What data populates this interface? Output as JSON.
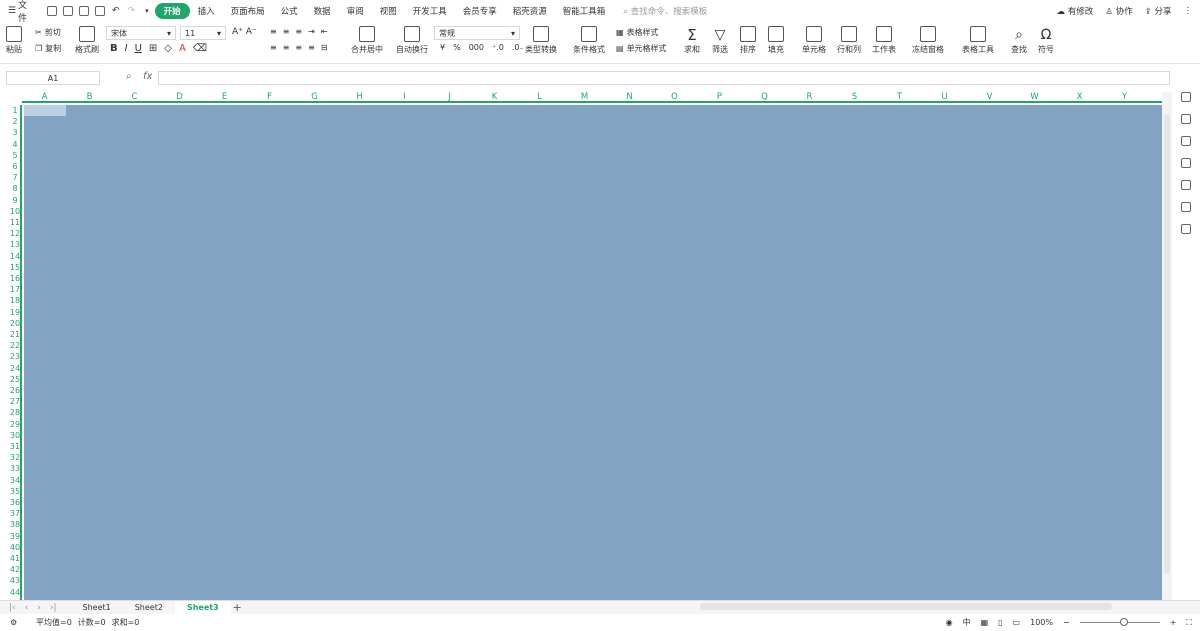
{
  "menubar": {
    "file": "文件",
    "items": [
      "开始",
      "插入",
      "页面布局",
      "公式",
      "数据",
      "审阅",
      "视图",
      "开发工具",
      "会员专享",
      "稻壳资源",
      "智能工具箱"
    ],
    "active_index": 0,
    "search_placeholder": "查找命令、搜索模板",
    "right": {
      "modify": "有修改",
      "collab": "协作",
      "share": "分享"
    }
  },
  "ribbon": {
    "paste": "粘贴",
    "cut": "剪切",
    "copy": "复制",
    "format_painter": "格式刷",
    "font_name": "宋体",
    "font_size": "11",
    "bold": "B",
    "italic": "I",
    "underline": "U",
    "merge_center": "合并居中",
    "wrap_text": "自动换行",
    "number_format": "常规",
    "currency": "¥",
    "percent": "%",
    "type_convert": "类型转换",
    "conditional_format": "条件格式",
    "table_style": "表格样式",
    "cell_style": "单元格样式",
    "sum": "求和",
    "filter": "筛选",
    "sort": "排序",
    "fill": "填充",
    "cell": "单元格",
    "row_col": "行和列",
    "worksheet": "工作表",
    "freeze": "冻结窗格",
    "table_tools": "表格工具",
    "find": "查找",
    "symbol": "符号"
  },
  "formula": {
    "name_box": "A1",
    "fx": "fx",
    "value": ""
  },
  "columns": [
    "A",
    "B",
    "C",
    "D",
    "E",
    "F",
    "G",
    "H",
    "I",
    "J",
    "K",
    "L",
    "M",
    "N",
    "O",
    "P",
    "Q",
    "R",
    "S",
    "T",
    "U",
    "V",
    "W",
    "X",
    "Y"
  ],
  "rows": [
    "1",
    "2",
    "3",
    "4",
    "5",
    "6",
    "7",
    "8",
    "9",
    "10",
    "11",
    "12",
    "13",
    "14",
    "15",
    "16",
    "17",
    "18",
    "19",
    "20",
    "21",
    "22",
    "23",
    "24",
    "25",
    "26",
    "27",
    "28",
    "29",
    "30",
    "31",
    "32",
    "33",
    "34",
    "35",
    "36",
    "37",
    "38",
    "39",
    "40",
    "41",
    "42",
    "43",
    "44"
  ],
  "sheets": [
    "Sheet1",
    "Sheet2",
    "Sheet3"
  ],
  "active_sheet": "Sheet3",
  "status": {
    "average": "平均值=0",
    "count": "计数=0",
    "sum": "求和=0",
    "zoom": "100%"
  },
  "colors": {
    "accent": "#1fa66a",
    "selection": "#82a3c2"
  }
}
